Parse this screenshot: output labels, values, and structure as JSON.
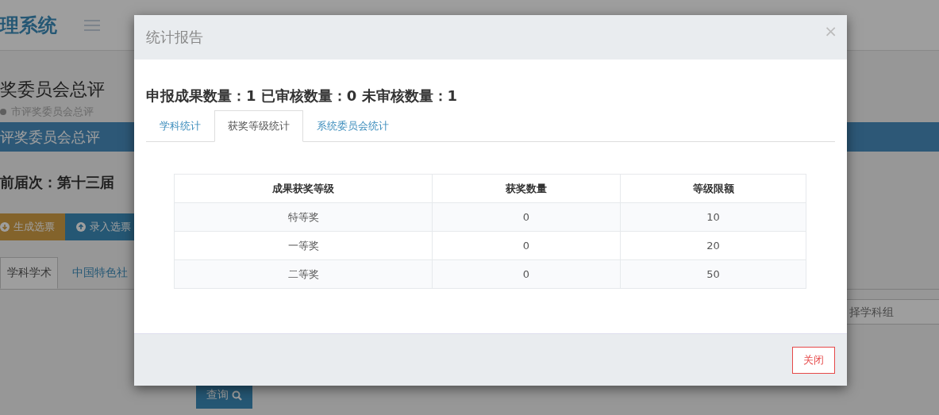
{
  "app_header": {
    "logo": "理系统"
  },
  "page": {
    "title": "奖委员会总评",
    "breadcrumb": "市评奖委员会总评",
    "panel_title": "评奖委员会总评",
    "session": "前届次：第十三届",
    "actions": [
      {
        "label": "生成选票",
        "kind": "download"
      },
      {
        "label": "录入选票",
        "kind": "upload"
      }
    ],
    "tabs": [
      {
        "label": "学科学术",
        "selected": true
      },
      {
        "label": "中国特色社",
        "selected": false
      }
    ],
    "form": {
      "group_select": {
        "placeholder": "择学科组"
      }
    },
    "query_button": "查询"
  },
  "modal": {
    "title": "统计报告",
    "close": "×",
    "summary": "申报成果数量：1 已审核数量：0 未审核数量：1",
    "tabs": [
      {
        "label": "学科统计",
        "selected": false
      },
      {
        "label": "获奖等级统计",
        "selected": true
      },
      {
        "label": "系统委员会统计",
        "selected": false
      }
    ],
    "table": {
      "columns": [
        "成果获奖等级",
        "获奖数量",
        "等级限额"
      ],
      "rows": [
        [
          "特等奖",
          "0",
          "10"
        ],
        [
          "一等奖",
          "0",
          "20"
        ],
        [
          "二等奖",
          "0",
          "50"
        ]
      ]
    },
    "footer_button": "关闭"
  }
}
